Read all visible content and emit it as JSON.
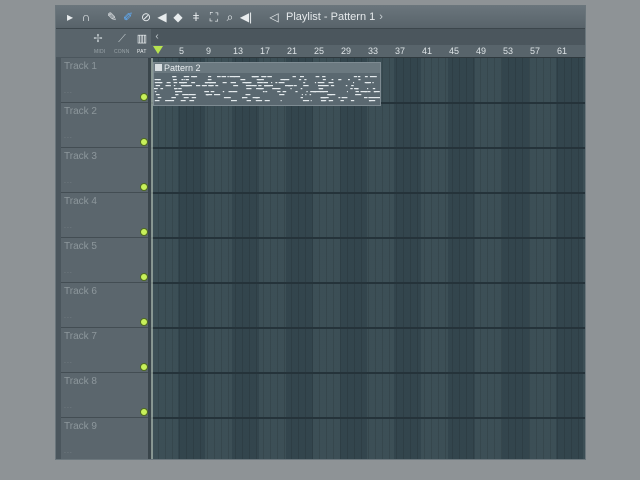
{
  "window": {
    "title": "Playlist - Pattern 1",
    "title_arrow": "›"
  },
  "toolbar": {
    "icons": [
      "play-icon",
      "magnet-icon",
      "pencil-icon",
      "brush-icon",
      "delete-icon",
      "mute-icon",
      "slip-icon",
      "slice-icon",
      "select-icon",
      "zoom-icon",
      "playback-icon"
    ],
    "active_icon": "brush-icon"
  },
  "toolbar2": {
    "labels": [
      "MIDI",
      "CONN",
      "PAT"
    ],
    "active_label": "PAT"
  },
  "ruler": {
    "bars": [
      "5",
      "9",
      "13",
      "17",
      "21",
      "25",
      "29",
      "33",
      "37",
      "41",
      "45",
      "49",
      "53",
      "57",
      "61"
    ]
  },
  "tracks": [
    {
      "name": "Track 1",
      "dots": "..."
    },
    {
      "name": "Track 2",
      "dots": "..."
    },
    {
      "name": "Track 3",
      "dots": "..."
    },
    {
      "name": "Track 4",
      "dots": "..."
    },
    {
      "name": "Track 5",
      "dots": "..."
    },
    {
      "name": "Track 6",
      "dots": "..."
    },
    {
      "name": "Track 7",
      "dots": "..."
    },
    {
      "name": "Track 8",
      "dots": "..."
    },
    {
      "name": "Track 9",
      "dots": "..."
    }
  ],
  "clip": {
    "label": "Pattern 2",
    "track": "Track 1"
  },
  "colors": {
    "led": "#c8f05a",
    "playhead": "#b7e34f",
    "grid_bg": "#364951",
    "active_tool": "#5fb0ff"
  }
}
